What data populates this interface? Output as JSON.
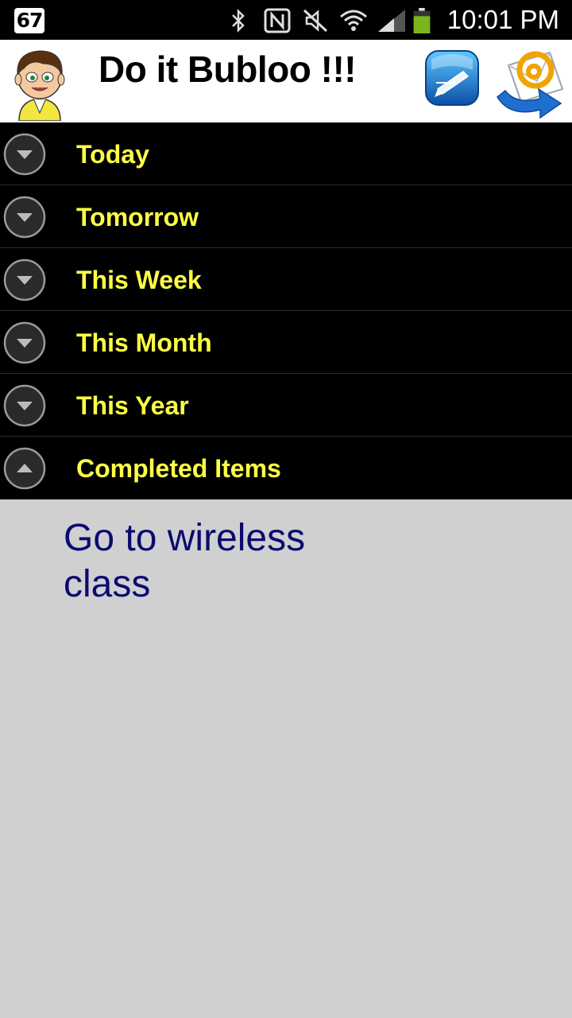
{
  "status_bar": {
    "notification_count": "67",
    "time": "10:01 PM",
    "icons": [
      "bluetooth-icon",
      "nfc-icon",
      "mute-icon",
      "wifi-icon",
      "signal-icon",
      "battery-icon"
    ]
  },
  "header": {
    "title": "Do it Bubloo !!!",
    "avatar_icon": "cartoon-boy-avatar",
    "edit_icon": "edit-note-icon",
    "mail_icon": "email-send-icon"
  },
  "sections": [
    {
      "label": "Today",
      "state": "collapsed"
    },
    {
      "label": "Tomorrow",
      "state": "collapsed"
    },
    {
      "label": "This Week",
      "state": "collapsed"
    },
    {
      "label": "This Month",
      "state": "collapsed"
    },
    {
      "label": "This Year",
      "state": "collapsed"
    },
    {
      "label": "Completed Items",
      "state": "expanded"
    }
  ],
  "completed_items": [
    {
      "text": "Go to wireless class"
    }
  ],
  "colors": {
    "section_label": "#ffff44",
    "section_bg": "#000000",
    "content_bg": "#d0d0d0",
    "task_text": "#0a0a70"
  }
}
